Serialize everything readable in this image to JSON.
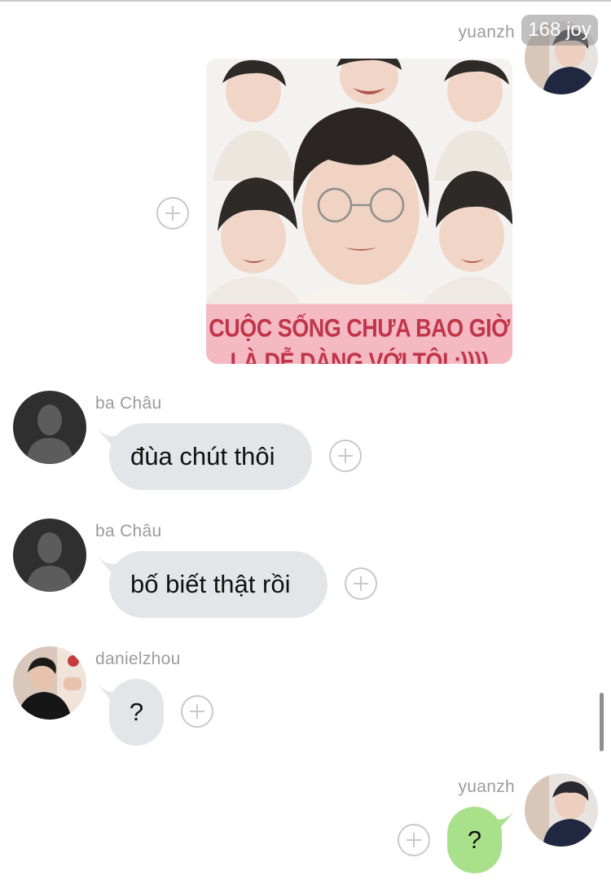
{
  "header": {
    "badge": "168 joy"
  },
  "messages": [
    {
      "sender": "yuanzh",
      "kind": "sticker",
      "sticker_caption": "CUỘC SỐNG CHƯA BAO GIỜ\nLÀ DỄ DÀNG VỚI TÔI :))))"
    },
    {
      "sender": "ba Châu",
      "kind": "text",
      "text": "đùa chút thôi"
    },
    {
      "sender": "ba Châu",
      "kind": "text",
      "text": "bố biết thật rồi"
    },
    {
      "sender": "danielzhou",
      "kind": "text",
      "text": "?"
    },
    {
      "sender": "yuanzh",
      "kind": "text",
      "text": "?"
    }
  ],
  "colors": {
    "incoming_bubble": "#e3e5e9",
    "outgoing_bubble": "#a9e08b",
    "sender_name": "#9b9b9b",
    "plus_icon": "#c9c9c9"
  },
  "icons": [
    "add-reaction-icon",
    "default-avatar-icon"
  ]
}
